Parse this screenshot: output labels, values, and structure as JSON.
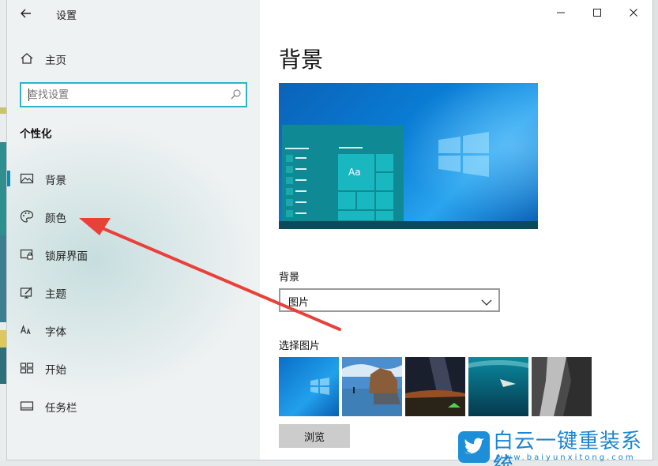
{
  "window": {
    "app_title": "设置",
    "controls": {
      "minimize": "—",
      "maximize": "☐",
      "close": "✕"
    }
  },
  "sidebar": {
    "home_label": "主页",
    "search_placeholder": "查找设置",
    "section_title": "个性化",
    "items": [
      {
        "label": "背景",
        "icon": "picture-icon",
        "active": true
      },
      {
        "label": "颜色",
        "icon": "palette-icon",
        "active": false
      },
      {
        "label": "锁屏界面",
        "icon": "lock-screen-icon",
        "active": false
      },
      {
        "label": "主题",
        "icon": "theme-icon",
        "active": false
      },
      {
        "label": "字体",
        "icon": "font-icon",
        "active": false
      },
      {
        "label": "开始",
        "icon": "start-icon",
        "active": false
      },
      {
        "label": "任务栏",
        "icon": "taskbar-icon",
        "active": false
      }
    ]
  },
  "main": {
    "title": "背景",
    "preview_tile_text": "Aa",
    "background_label": "背景",
    "background_value": "图片",
    "choose_picture_label": "选择图片",
    "browse_label": "浏览"
  },
  "watermark": {
    "brand": "白云一键重装系统",
    "url": "www.baiyunxitong.com"
  },
  "colors": {
    "accent": "#008fbf",
    "search_border": "#2eb4c7",
    "arrow": "#e8413a"
  }
}
